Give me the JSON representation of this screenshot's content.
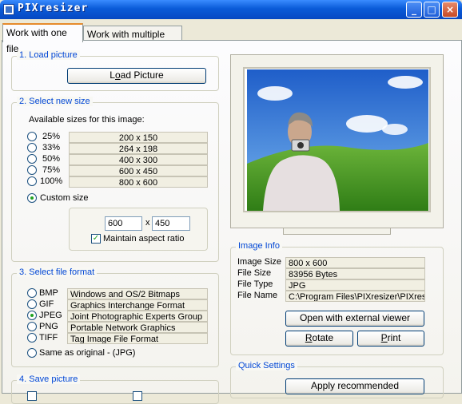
{
  "window": {
    "title": "PIXresizer",
    "controls": {
      "minimize": "_",
      "maximize": "□",
      "close": "×"
    }
  },
  "tabs": [
    {
      "label": "Work with one file",
      "active": true
    },
    {
      "label": "Work with multiple files",
      "active": false
    }
  ],
  "load": {
    "title": "1. Load picture",
    "button": "Load Picture"
  },
  "size": {
    "title": "2. Select new size",
    "available_label": "Available sizes for this image:",
    "options": [
      {
        "percent": "25%",
        "dims": "200  x  150"
      },
      {
        "percent": "33%",
        "dims": "264  x  198"
      },
      {
        "percent": "50%",
        "dims": "400  x  300"
      },
      {
        "percent": "75%",
        "dims": "600  x  450"
      },
      {
        "percent": "100%",
        "dims": "800  x  600"
      }
    ],
    "custom_label": "Custom size",
    "width": "600",
    "x_sep": "x",
    "height": "450",
    "aspect_label": "Maintain aspect ratio",
    "aspect_checked": true
  },
  "format": {
    "title": "3. Select file format",
    "options": [
      {
        "ext": "BMP",
        "desc": "Windows and OS/2 Bitmaps",
        "selected": false
      },
      {
        "ext": "GIF",
        "desc": "Graphics Interchange Format",
        "selected": false
      },
      {
        "ext": "JPEG",
        "desc": "Joint Photographic Experts Group",
        "selected": true
      },
      {
        "ext": "PNG",
        "desc": "Portable Network Graphics",
        "selected": false
      },
      {
        "ext": "TIFF",
        "desc": "Tag Image File Format",
        "selected": false
      }
    ],
    "same_as_original": "Same as original  - (JPG)"
  },
  "save": {
    "title": "4. Save picture"
  },
  "image_info": {
    "title": "Image Info",
    "rows": [
      {
        "label": "Image Size",
        "value": "800 x 600"
      },
      {
        "label": "File Size",
        "value": "83956 Bytes"
      },
      {
        "label": "File Type",
        "value": "JPG"
      },
      {
        "label": "File Name",
        "value": "C:\\Program Files\\PIXresizer\\PIXresiz"
      }
    ],
    "open_external": "Open with external viewer",
    "rotate": "Rotate",
    "print": "Print"
  },
  "quick_settings": {
    "title": "Quick Settings",
    "apply": "Apply recommended"
  },
  "colors": {
    "title_bar": "#0a5bd8",
    "group_title": "#0046d5",
    "radio_dot": "#21a121"
  }
}
